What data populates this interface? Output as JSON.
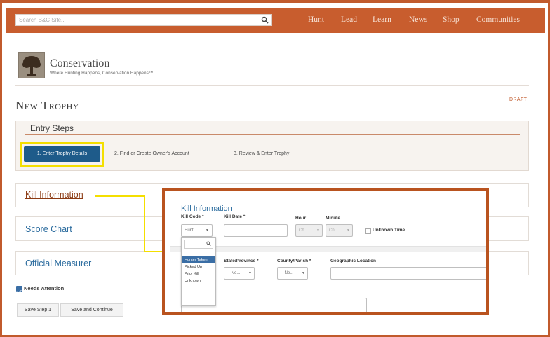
{
  "search": {
    "placeholder": "Search B&C Site..."
  },
  "nav": [
    "Hunt",
    "Lead",
    "Learn",
    "News",
    "Shop",
    "Communities"
  ],
  "site": {
    "name": "Conservation",
    "tagline": "Where Hunting Happens, Conservation Happens™"
  },
  "page": {
    "title": "New Trophy",
    "status": "DRAFT"
  },
  "entry_steps": {
    "title": "Entry Steps",
    "steps": [
      "1. Enter Trophy Details",
      "2. Find or Create Owner's Account",
      "3. Review & Enter Trophy"
    ]
  },
  "sections": [
    "Kill Information",
    "Score Chart",
    "Official Measurer"
  ],
  "needs_attention": "Needs Attention",
  "buttons": {
    "save_step": "Save Step 1",
    "save_continue": "Save and Continue"
  },
  "zoom": {
    "title": "Kill Information",
    "labels": {
      "kill_code": "Kill Code *",
      "kill_date": "Kill Date *",
      "hour": "Hour",
      "minute": "Minute",
      "unknown_time": "Unknown Time",
      "state": "State/Province *",
      "county": "County/Parish *",
      "geo": "Geographic Location"
    },
    "kill_code_value": "Hunt...",
    "hour_value": "Ch...",
    "minute_value": "Ch...",
    "state_value": "-- Ne...",
    "county_value": "-- Ne...",
    "options": [
      "Hunter Taken",
      "Picked Up",
      "Prior Kill",
      "Unknown"
    ],
    "selected_option": "Hunter Taken"
  },
  "colors": {
    "brand_orange": "#c85d2e",
    "step_active": "#1e5b8a",
    "highlight": "#f4df00",
    "link_blue": "#2d6d9f"
  },
  "icons": [
    "search-icon",
    "tree-logo-icon",
    "checkbox-checked-icon",
    "chevron-down-icon"
  ]
}
